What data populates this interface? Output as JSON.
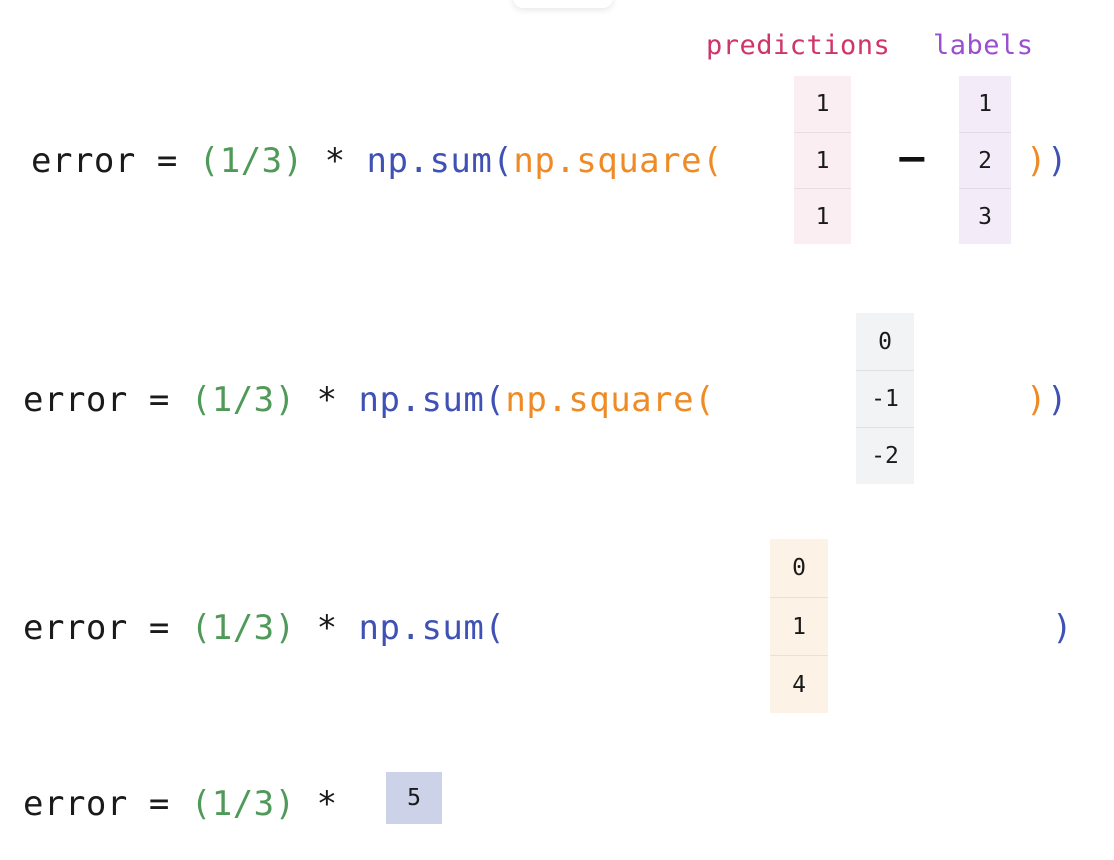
{
  "page": {
    "background": "#ffffff",
    "description_rows": 4
  },
  "palette": {
    "plain": "#1a1a1a",
    "green": "#4f9a58",
    "blue": "#3f51b5",
    "orange": "#ef8b26",
    "predictions_label": "#cf3568",
    "labels_label": "#9a4fce",
    "predictions_cell_bg": "#fbeef3",
    "labels_cell_bg": "#f3ecf8",
    "diff_cell_bg": "#f2f3f4",
    "squared_cell_bg": "#fcf3e6",
    "scalar_bg": "#ccd2e8"
  },
  "vector_labels": {
    "predictions": "predictions",
    "labels": "labels"
  },
  "operators": {
    "minus": "−"
  },
  "rows": [
    {
      "id": "row-expanded",
      "code_segments": [
        {
          "text": "error = ",
          "color": "plain"
        },
        {
          "text": "(1/3)",
          "color": "green"
        },
        {
          "text": " * ",
          "color": "plain"
        },
        {
          "text": "np.sum(",
          "color": "blue"
        },
        {
          "text": "np.square(",
          "color": "orange"
        }
      ],
      "tail_segments": [
        {
          "text": ")",
          "color": "orange"
        },
        {
          "text": ")",
          "color": "blue"
        }
      ],
      "vectors": [
        {
          "name": "predictions",
          "values": [
            "1",
            "1",
            "1"
          ]
        },
        {
          "name": "labels",
          "values": [
            "1",
            "2",
            "3"
          ]
        }
      ]
    },
    {
      "id": "row-difference",
      "code_segments": [
        {
          "text": "error = ",
          "color": "plain"
        },
        {
          "text": "(1/3)",
          "color": "green"
        },
        {
          "text": " * ",
          "color": "plain"
        },
        {
          "text": "np.sum(",
          "color": "blue"
        },
        {
          "text": "np.square(",
          "color": "orange"
        }
      ],
      "tail_segments": [
        {
          "text": ")",
          "color": "orange"
        },
        {
          "text": ")",
          "color": "blue"
        }
      ],
      "vectors": [
        {
          "name": "difference",
          "values": [
            "0",
            "-1",
            "-2"
          ]
        }
      ]
    },
    {
      "id": "row-squared",
      "code_segments": [
        {
          "text": "error = ",
          "color": "plain"
        },
        {
          "text": "(1/3)",
          "color": "green"
        },
        {
          "text": " * ",
          "color": "plain"
        },
        {
          "text": "np.sum(",
          "color": "blue"
        }
      ],
      "tail_segments": [
        {
          "text": ")",
          "color": "blue"
        }
      ],
      "vectors": [
        {
          "name": "squared",
          "values": [
            "0",
            "1",
            "4"
          ]
        }
      ]
    },
    {
      "id": "row-summed",
      "code_segments": [
        {
          "text": "error = ",
          "color": "plain"
        },
        {
          "text": "(1/3)",
          "color": "green"
        },
        {
          "text": " * ",
          "color": "plain"
        }
      ],
      "tail_segments": [],
      "scalar": "5"
    }
  ]
}
